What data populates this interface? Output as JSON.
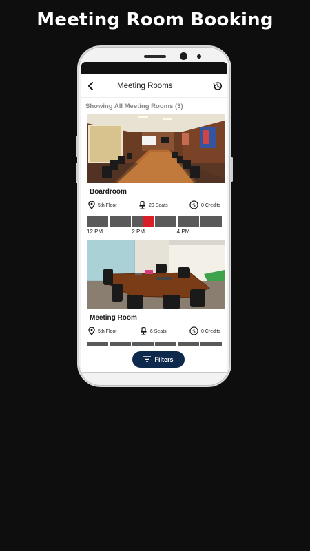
{
  "headline": "Meeting Room Booking",
  "app": {
    "title": "Meeting Rooms",
    "back_icon": "back-arrow-icon",
    "history_icon": "history-icon"
  },
  "showing_text": "Showing All Meeting Rooms (3)",
  "rooms": [
    {
      "name": "Boardroom",
      "floor": "5th Floor",
      "seats": "20 Seats",
      "credits": "0 Credits",
      "timeline": {
        "slot_count": 6,
        "booked": {
          "slot": 2,
          "start_fraction": 0.5,
          "end_fraction": 1.0
        },
        "labels": [
          "12 PM",
          "2 PM",
          "4 PM"
        ]
      }
    },
    {
      "name": "Meeting Room",
      "floor": "5th Floor",
      "seats": "6 Seats",
      "credits": "0 Credits"
    }
  ],
  "filters_label": "Filters",
  "colors": {
    "accent_navy": "#0d2a4d",
    "booked_red": "#d61f26",
    "slot_gray": "#5a5a5a"
  }
}
